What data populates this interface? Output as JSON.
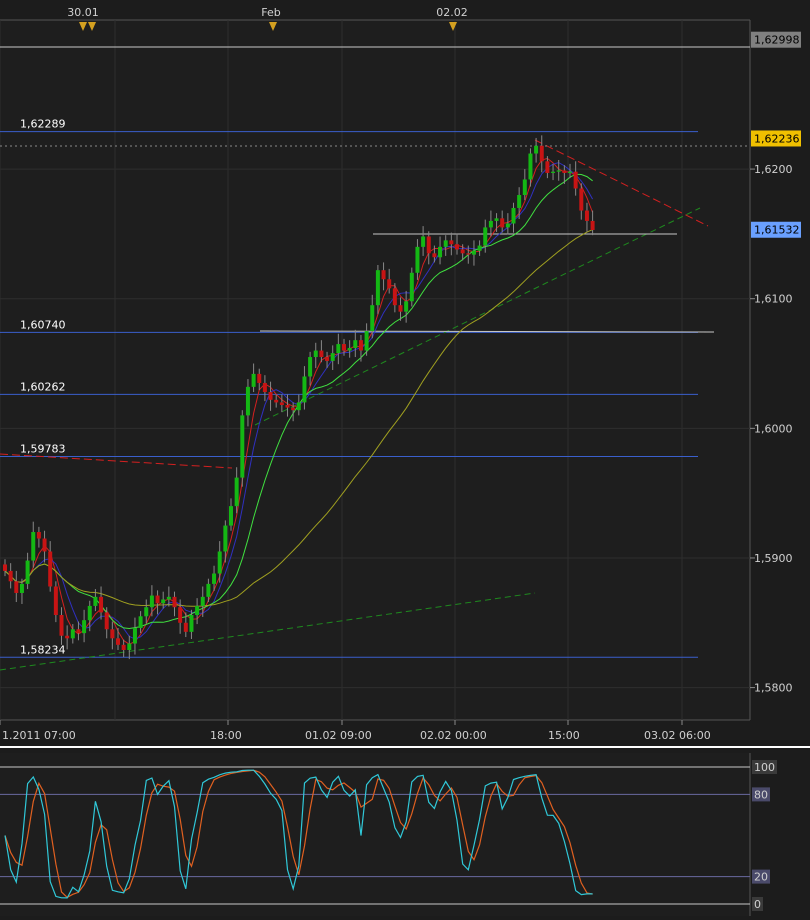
{
  "chart_data": [
    {
      "type": "candlestick",
      "title": "",
      "y_range": [
        1.5775,
        1.6315
      ],
      "time_labels": [
        "30.01",
        "Feb",
        "02.02"
      ],
      "x_labels": [
        "1.2011 07:00",
        "18:00",
        "01.02 09:00",
        "02.02 00:00",
        "15:00",
        "03.02 06:00"
      ],
      "y_ticks": [
        "1,6200",
        "1,6100",
        "1,6000",
        "1,5900",
        "1,5800"
      ],
      "y_tick_values": [
        1.62,
        1.61,
        1.6,
        1.59,
        1.58
      ],
      "price_tags": [
        {
          "label": "1,62998",
          "value": 1.62998,
          "color": "#808080",
          "text_color": "#000000"
        },
        {
          "label": "1,62236",
          "value": 1.62236,
          "color": "#f0c000",
          "text_color": "#000000"
        },
        {
          "label": "1,61532",
          "value": 1.61532,
          "color": "#6aa0ff",
          "text_color": "#000000"
        }
      ],
      "levels": [
        {
          "label": "1,62289",
          "value": 1.62289
        },
        {
          "label": "1,60740",
          "value": 1.6074
        },
        {
          "label": "1,60262",
          "value": 1.60262
        },
        {
          "label": "1,59783",
          "value": 1.59783
        },
        {
          "label": "1,58234",
          "value": 1.58234
        }
      ],
      "colors": {
        "up": "#14b814",
        "down": "#c81414",
        "level": "#3a5fcc",
        "ma_fast": "#d42020",
        "ma_mid": "#3030c0",
        "ma_green": "#40e040",
        "ma_slow": "#a0a020"
      },
      "closes": [
        1.589,
        1.5882,
        1.5873,
        1.588,
        1.5898,
        1.592,
        1.5915,
        1.5905,
        1.5878,
        1.5856,
        1.584,
        1.5838,
        1.5845,
        1.5842,
        1.5852,
        1.5863,
        1.587,
        1.5858,
        1.5845,
        1.5838,
        1.5833,
        1.5829,
        1.5834,
        1.5846,
        1.5855,
        1.5862,
        1.5871,
        1.5865,
        1.5868,
        1.587,
        1.5862,
        1.585,
        1.5843,
        1.5856,
        1.5863,
        1.587,
        1.588,
        1.5888,
        1.5905,
        1.5925,
        1.594,
        1.5962,
        1.601,
        1.6032,
        1.6042,
        1.6035,
        1.6028,
        1.6022,
        1.602,
        1.6018,
        1.6016,
        1.6014,
        1.602,
        1.604,
        1.6055,
        1.606,
        1.6055,
        1.6052,
        1.6058,
        1.6065,
        1.606,
        1.6062,
        1.6068,
        1.606,
        1.6075,
        1.6095,
        1.6122,
        1.6115,
        1.6108,
        1.6095,
        1.609,
        1.6098,
        1.612,
        1.614,
        1.6148,
        1.6135,
        1.6132,
        1.614,
        1.6145,
        1.6142,
        1.6138,
        1.6135,
        1.6134,
        1.6137,
        1.6141,
        1.6155,
        1.616,
        1.6162,
        1.6155,
        1.6158,
        1.617,
        1.618,
        1.6192,
        1.6212,
        1.6218,
        1.6206,
        1.6197,
        1.6198,
        1.6199,
        1.6197,
        1.6198,
        1.6185,
        1.6168,
        1.616,
        1.6153
      ],
      "stoch_ticks": [
        "100",
        "80",
        "20",
        "0"
      ],
      "stoch_tick_values": [
        100,
        80,
        20,
        0
      ]
    }
  ]
}
